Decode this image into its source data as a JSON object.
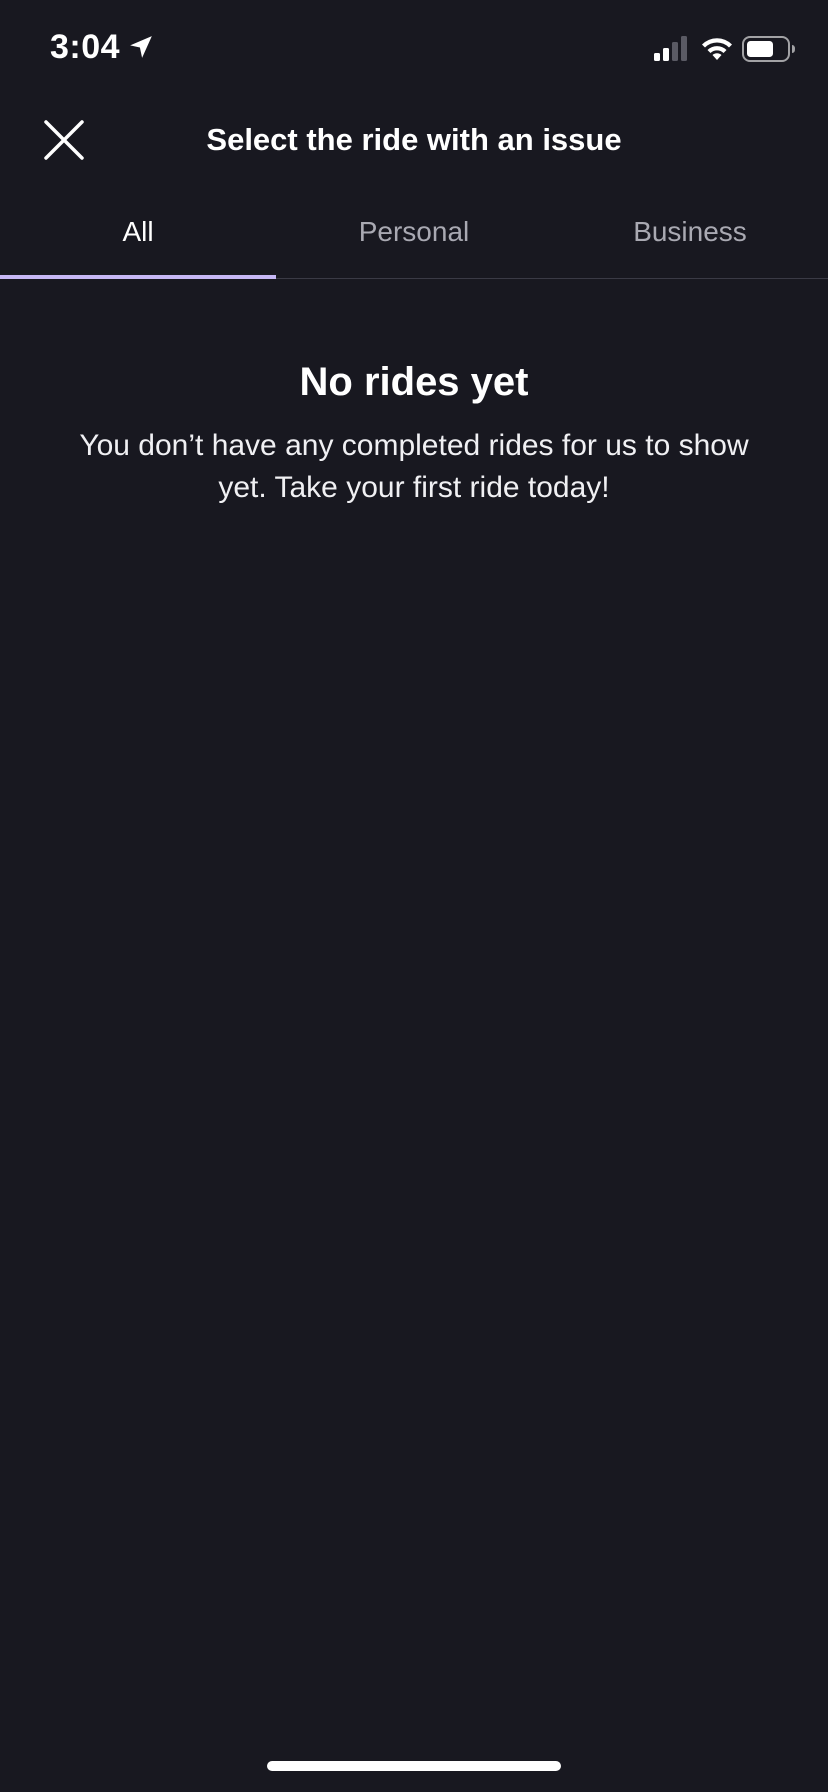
{
  "status_bar": {
    "time": "3:04",
    "icons": [
      "location-arrow-icon",
      "cellular-signal-icon",
      "wifi-icon",
      "battery-icon"
    ]
  },
  "header": {
    "title": "Select the ride with an issue",
    "close_icon": "close-icon"
  },
  "tabs": [
    {
      "label": "All",
      "active": true
    },
    {
      "label": "Personal",
      "active": false
    },
    {
      "label": "Business",
      "active": false
    }
  ],
  "empty_state": {
    "title": "No rides yet",
    "message": "You don’t have any completed rides for us to show yet. Take your first ride today!"
  },
  "colors": {
    "background": "#181820",
    "accent": "#c6b7f5",
    "text_primary": "#ffffff",
    "text_secondary": "#a9a9b2"
  }
}
